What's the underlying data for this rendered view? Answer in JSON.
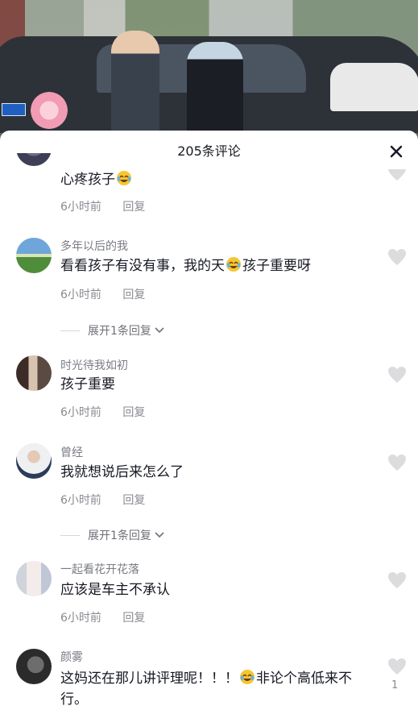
{
  "header": {
    "title": "205条评论",
    "close_icon": "close-icon"
  },
  "comments": [
    {
      "username": "",
      "content": "心疼孩子",
      "emoji_after": true,
      "time": "6小时前",
      "reply_label": "回复"
    },
    {
      "username": "多年以后的我",
      "content_a": "看看孩子有没有事，我的天",
      "content_b": "孩子重要呀",
      "time": "6小时前",
      "reply_label": "回复",
      "expand_label": "展开1条回复"
    },
    {
      "username": "时光待我如初",
      "content": "孩子重要",
      "time": "6小时前",
      "reply_label": "回复"
    },
    {
      "username": "曾经",
      "content": "我就想说后来怎么了",
      "time": "6小时前",
      "reply_label": "回复",
      "expand_label": "展开1条回复"
    },
    {
      "username": "一起看花开花落",
      "content": "应该是车主不承认",
      "time": "6小时前",
      "reply_label": "回复"
    },
    {
      "username": "颜雾",
      "content_a": "这妈还在那儿讲评理呢！！！",
      "content_b": "非论个高低来不行。",
      "like_count": "1"
    }
  ],
  "colors": {
    "text": "#161823",
    "secondary": "#8a8b91",
    "like_icon": "#dcdcde"
  }
}
